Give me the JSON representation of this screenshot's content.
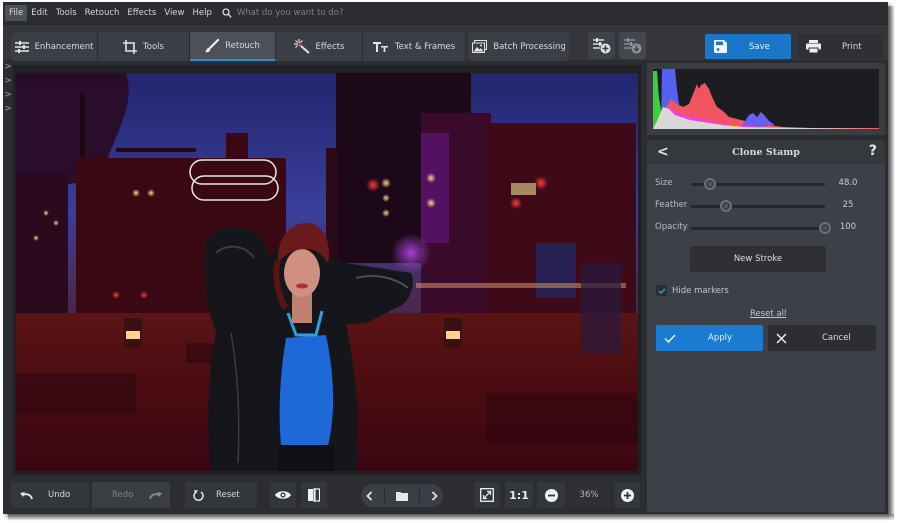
{
  "menubar": {
    "items": [
      {
        "label": "File",
        "active": true
      },
      {
        "label": "Edit"
      },
      {
        "label": "Tools"
      },
      {
        "label": "Retouch"
      },
      {
        "label": "Effects"
      },
      {
        "label": "View"
      },
      {
        "label": "Help"
      }
    ],
    "search_placeholder": "What do you want to do?"
  },
  "toolbar": {
    "tabs": [
      {
        "label": "Enhancement",
        "icon": "sliders-icon"
      },
      {
        "label": "Tools",
        "icon": "crop-icon"
      },
      {
        "label": "Retouch",
        "icon": "brush-icon",
        "active": true
      },
      {
        "label": "Effects",
        "icon": "magic-wand-icon"
      },
      {
        "label": "Text & Frames",
        "icon": "text-icon"
      }
    ],
    "batch_label": "Batch Processing",
    "save_label": "Save",
    "print_label": "Print",
    "accent_color": "#1976c8"
  },
  "bottombar": {
    "undo_label": "Undo",
    "redo_label": "Redo",
    "reset_label": "Reset",
    "fit_label": "1:1",
    "zoom_value": "36%"
  },
  "panel": {
    "tool_title": "Clone Stamp",
    "help_glyph": "?",
    "back_glyph": "<",
    "sliders": [
      {
        "label": "Size",
        "value": "48.0",
        "fraction": 0.14
      },
      {
        "label": "Feather",
        "value": "25",
        "fraction": 0.26
      },
      {
        "label": "Opacity",
        "value": "100",
        "fraction": 1.0
      }
    ],
    "new_stroke_label": "New Stroke",
    "hide_markers_label": "Hide markers",
    "hide_markers_checked": true,
    "reset_all_label": "Reset all",
    "apply_label": "Apply",
    "cancel_label": "Cancel"
  },
  "left_strip": {
    "chevrons": [
      ">",
      ">",
      ">",
      ">"
    ]
  }
}
